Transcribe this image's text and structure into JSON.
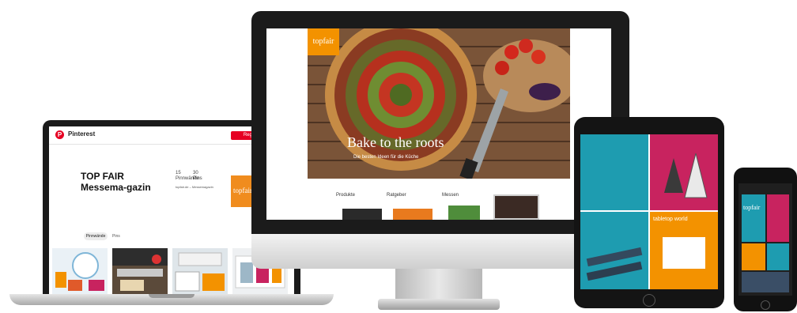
{
  "laptop": {
    "brand": "Pinterest",
    "logo_glyph": "P",
    "button": "Registrieren",
    "title": "TOP FAIR Messema-gazin",
    "stats": [
      {
        "value": "15",
        "label": "Pinnwände"
      },
      {
        "value": "30",
        "label": "Pins"
      }
    ],
    "description": "topfair.de – Messemagazin",
    "thumb": "topfair",
    "tabs": [
      "Pinnwände",
      "Pins"
    ]
  },
  "imac": {
    "badge": "topfair",
    "headline": "Bake to the roots",
    "subline": "Die besten Ideen für die Küche",
    "categories": [
      "Produkte",
      "Ratgeber",
      "Messen"
    ]
  },
  "tablet": {
    "tile_labels": [
      "tabletop world"
    ]
  },
  "phone": {
    "badge": "topfair"
  },
  "colors": {
    "orange": "#f39200",
    "pinterest_red": "#e60023",
    "magenta": "#c8235f",
    "teal": "#1e9cb0"
  }
}
